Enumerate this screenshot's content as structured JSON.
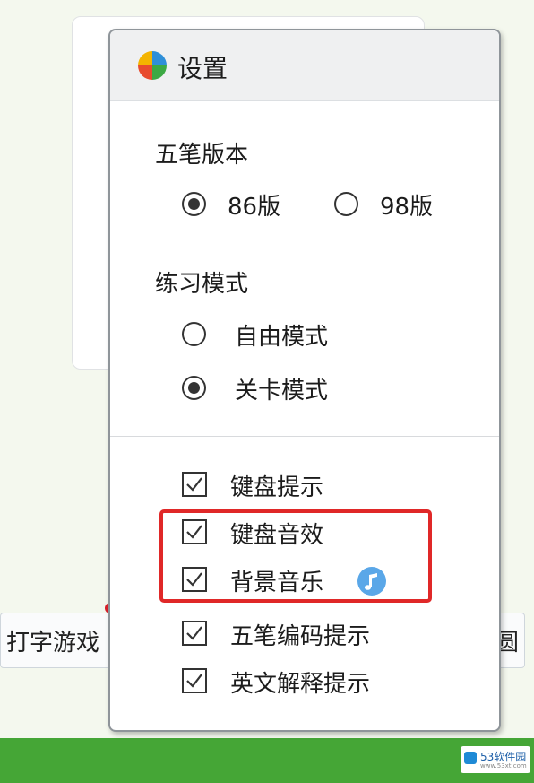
{
  "background": {
    "left_button_label": "打字游戏",
    "right_button_label": "圆",
    "watermark": {
      "main": "53软件园",
      "sub": "www.53xt.com"
    }
  },
  "dialog": {
    "title": "设置",
    "sections": {
      "version": {
        "label": "五笔版本",
        "options": [
          {
            "label": "86版",
            "selected": true
          },
          {
            "label": "98版",
            "selected": false
          }
        ]
      },
      "mode": {
        "label": "练习模式",
        "options": [
          {
            "label": "自由模式",
            "selected": false
          },
          {
            "label": "关卡模式",
            "selected": true
          }
        ]
      }
    },
    "checkboxes": [
      {
        "label": "键盘提示",
        "checked": true
      },
      {
        "label": "键盘音效",
        "checked": true
      },
      {
        "label": "背景音乐",
        "checked": true
      },
      {
        "label": "五笔编码提示",
        "checked": true
      },
      {
        "label": "英文解释提示",
        "checked": true
      }
    ]
  },
  "colors": {
    "highlight_border": "#e02828",
    "music_icon": "#5aa7e8",
    "bottom_bar": "#45a636"
  }
}
